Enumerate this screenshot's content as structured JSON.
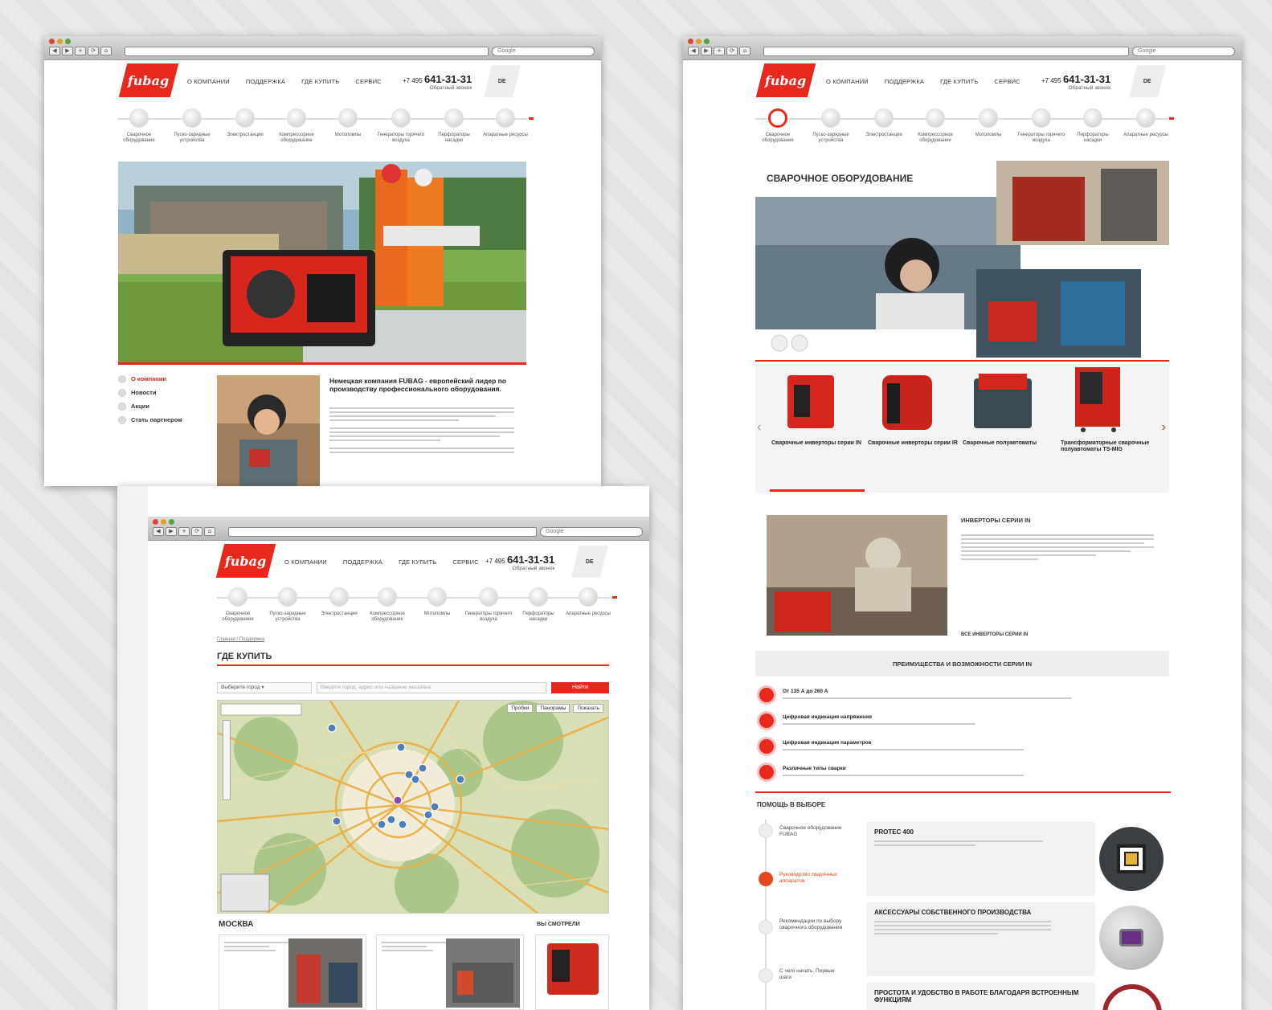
{
  "browser": {
    "search_placeholder": "Google"
  },
  "site": {
    "logo_text": "fubag",
    "nav": [
      "О КОМПАНИИ",
      "ПОДДЕРЖКА",
      "ГДЕ КУПИТЬ",
      "СЕРВИС"
    ],
    "phone_prefix": "+7 495",
    "phone_number": "641-31-31",
    "phone_caption": "Обратный звонок",
    "lang": "DE",
    "categories": [
      "Сварочное оборудование",
      "Пуско-зарядные устройства",
      "Электростанции",
      "Компрессорное оборудование",
      "Мотопомпы",
      "Генераторы горячего воздуха",
      "Перфораторы насадки",
      "Апаратные ресурсы"
    ]
  },
  "page1": {
    "sidebar": [
      "О компании",
      "Новости",
      "Акции",
      "Стать партнером"
    ],
    "about_heading": "Немецкая компания FUBAG - европейский лидер по производству профессионального оборудования."
  },
  "page2": {
    "title": "СВАРОЧНОЕ ОБОРУДОВАНИЕ",
    "products": [
      {
        "title": "Сварочные инверторы серии IN"
      },
      {
        "title": "Сварочные инверторы серии IR"
      },
      {
        "title": "Сварочные полуавтоматы"
      },
      {
        "title": "Трансформаторные сварочные полуавтоматы TS-MIG"
      }
    ],
    "feature_title": "ИНВЕРТОРЫ СЕРИИ IN",
    "feature_link": "ВСЕ ИНВЕРТОРЫ СЕРИИ IN",
    "advantages_title": "ПРЕИМУЩЕСТВА И ВОЗМОЖНОСТИ СЕРИИ IN",
    "advantages": [
      "От 135 А до 260 А",
      "Цифровая индикация напряжения",
      "Цифровая индикация параметров",
      "Различные типы сварки"
    ],
    "help_title": "ПОМОЩЬ В ВЫБОРЕ",
    "help_steps": [
      "Сварочное оборудование FUBAG",
      "Руководство сварочных аппаратов",
      "Рекомендации по выбору сварочного оборудования",
      "С чего начать. Первые шаги"
    ],
    "help_cards": [
      {
        "title": "PROTEC 400"
      },
      {
        "title": "АКСЕССУАРЫ СОБСТВЕННОГО ПРОИЗВОДСТВА"
      },
      {
        "title": "ПРОСТОТА И УДОБСТВО В РАБОТЕ БЛАГОДАРЯ ВСТРОЕННЫМ ФУНКЦИЯМ"
      }
    ]
  },
  "page3": {
    "breadcrumb": "Главная / Поддержка",
    "title": "ГДЕ КУПИТЬ",
    "city_select": "Выберите город",
    "search_placeholder": "Введите город, адрес или название магазина",
    "find_button": "Найти",
    "map_buttons": [
      "Пробки",
      "Панорамы",
      "Показать"
    ],
    "city": "МОСКВА",
    "viewed": "ВЫ СМОТРЕЛИ"
  }
}
